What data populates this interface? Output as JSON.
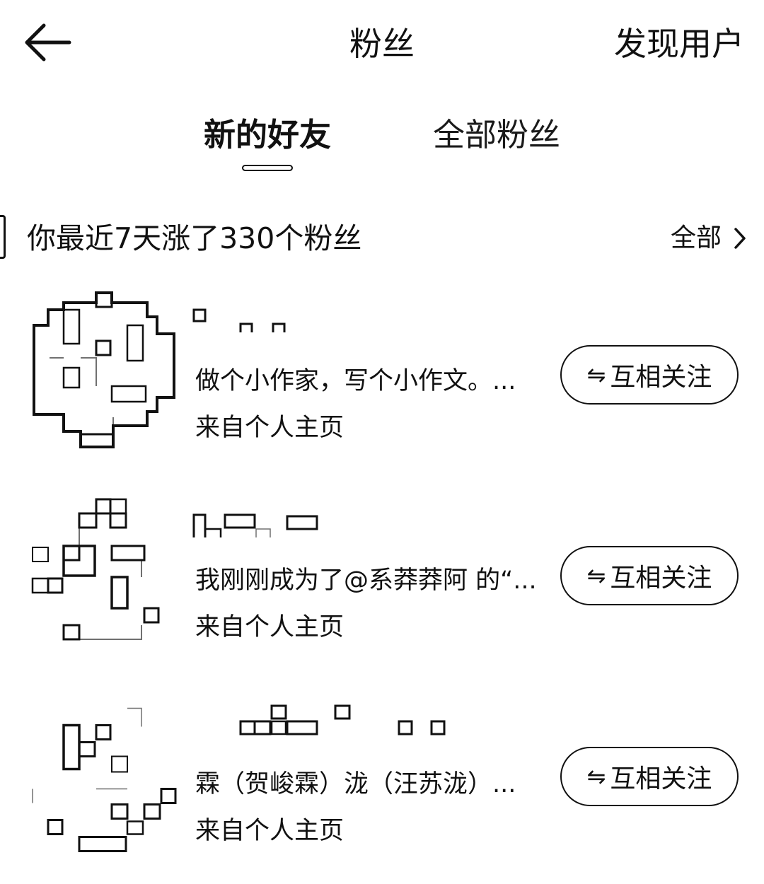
{
  "header": {
    "title": "粉丝",
    "discover_label": "发现用户",
    "back_icon": "arrow-left-icon"
  },
  "tabs": [
    {
      "label": "新的好友",
      "active": true
    },
    {
      "label": "全部粉丝",
      "active": false
    }
  ],
  "summary": {
    "text": "你最近7天涨了330个粉丝",
    "all_label": "全部",
    "chevron_icon": "chevron-right-icon"
  },
  "fans": [
    {
      "bio": "做个小作家，写个小作文。...",
      "source": "来自个人主页",
      "button_icon": "⇋",
      "button_label": "互相关注"
    },
    {
      "bio": "我刚刚成为了@系莽莽阿 的“...",
      "source": "来自个人主页",
      "button_icon": "⇋",
      "button_label": "互相关注"
    },
    {
      "bio": "霖（贺峻霖）泷（汪苏泷）...",
      "source": "来自个人主页",
      "button_icon": "⇋",
      "button_label": "互相关注"
    }
  ]
}
